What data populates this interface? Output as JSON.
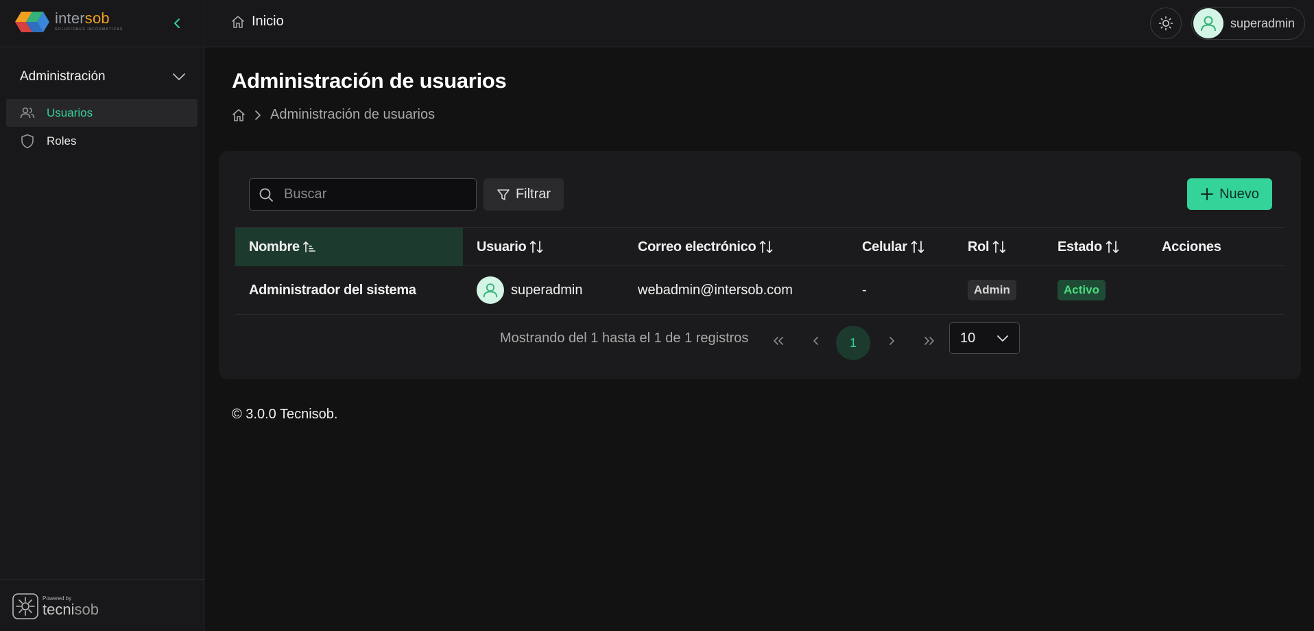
{
  "brand": {
    "name_part1": "inter",
    "name_part2": "sob",
    "tagline": "SOLUCIONES INFORMÁTICAS"
  },
  "sidebar": {
    "section_title": "Administración",
    "items": [
      {
        "label": "Usuarios",
        "icon": "users-icon",
        "active": true
      },
      {
        "label": "Roles",
        "icon": "shield-icon",
        "active": false
      }
    ],
    "powered_by": {
      "small": "Powered by",
      "brand_part1": "tecni",
      "brand_part2": "sob"
    }
  },
  "topbar": {
    "home_label": "Inicio",
    "user_name": "superadmin"
  },
  "page": {
    "title": "Administración de usuarios",
    "breadcrumb": [
      "Administración de usuarios"
    ]
  },
  "toolbar": {
    "search_placeholder": "Buscar",
    "filter_label": "Filtrar",
    "new_label": "Nuevo"
  },
  "table": {
    "columns": [
      "Nombre",
      "Usuario",
      "Correo electrónico",
      "Celular",
      "Rol",
      "Estado",
      "Acciones"
    ],
    "rows": [
      {
        "nombre": "Administrador del sistema",
        "usuario": "superadmin",
        "correo": "webadmin@intersob.com",
        "celular": "-",
        "rol": "Admin",
        "estado": "Activo"
      }
    ]
  },
  "pagination": {
    "info": "Mostrando del 1 hasta el 1 de 1 registros",
    "current_page": "1",
    "rows_per_page": "10"
  },
  "footer": {
    "text": "© 3.0.0 Tecnisob."
  },
  "colors": {
    "accent": "#34d399",
    "background": "#121212",
    "surface": "#1b1b1d",
    "sorted_header": "#1d3a2f"
  }
}
